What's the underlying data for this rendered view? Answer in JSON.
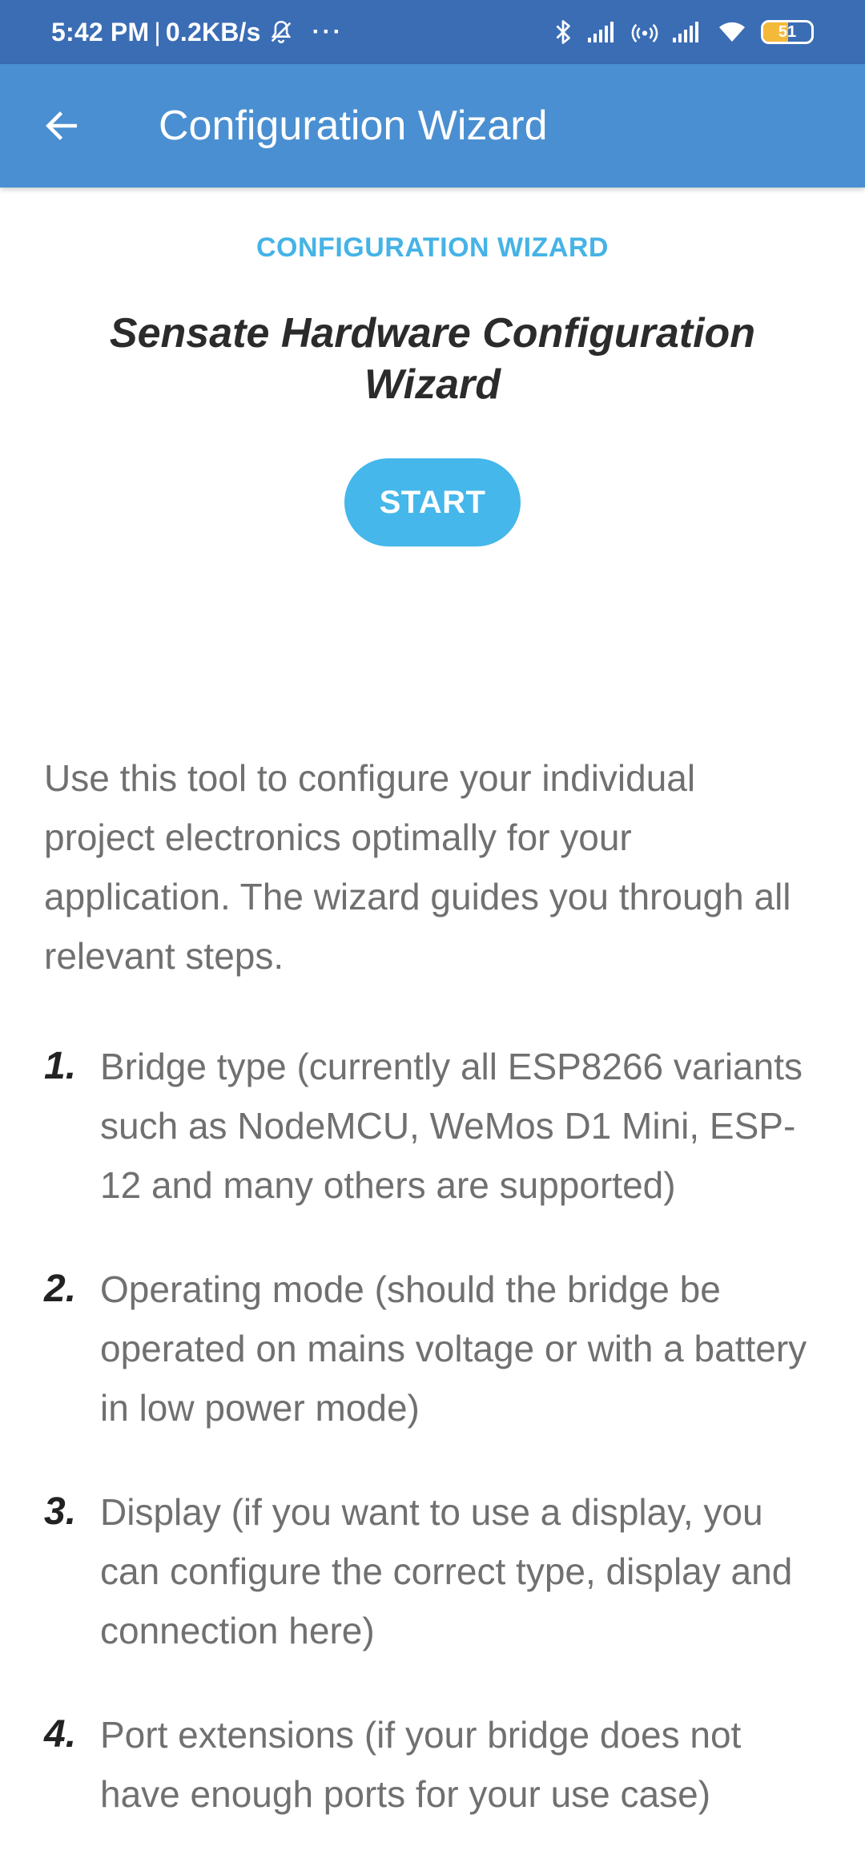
{
  "status_bar": {
    "time": "5:42 PM",
    "separator": "|",
    "speed": "0.2KB/s",
    "more": "···",
    "battery_level": "51",
    "battery_percent": 51,
    "icons": [
      "mute-icon",
      "bluetooth-icon",
      "signal-icon",
      "hotspot-icon",
      "signal-icon",
      "wifi-icon",
      "battery-icon"
    ]
  },
  "app_bar": {
    "title": "Configuration Wizard",
    "back_icon": "arrow-left-icon",
    "color": "#4a8fd1"
  },
  "content": {
    "section_label": "CONFIGURATION WIZARD",
    "hero_title": "Sensate Hardware Configuration Wizard",
    "start_label": "START",
    "accent_color": "#45b7ea",
    "intro": "Use this tool to configure your individual project electronics optimally for your application. The wizard guides you through all relevant steps.",
    "steps": [
      {
        "number": "1.",
        "text": "Bridge type (currently all ESP8266 variants such as NodeMCU, WeMos D1 Mini, ESP-12 and many others are supported)"
      },
      {
        "number": "2.",
        "text": "Operating mode (should the bridge be operated on mains voltage or with a battery in low power mode)"
      },
      {
        "number": "3.",
        "text": "Display (if you want to use a display, you can configure the correct type, display and connection here)"
      },
      {
        "number": "4.",
        "text": "Port extensions (if your bridge does not have enough ports for your use case)"
      }
    ]
  }
}
